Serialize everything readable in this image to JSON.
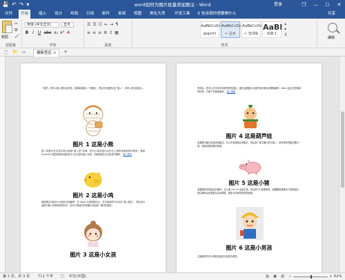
{
  "window": {
    "title": "word如何为图片批量添加题注 - Word",
    "login": "登录",
    "controls": {
      "restore": "❐",
      "minimize": "—",
      "maximize": "☐",
      "close": "✕"
    }
  },
  "qat": {
    "save": "💾",
    "undo": "↶",
    "redo": "↷",
    "more": "▾"
  },
  "tabs": [
    "文件",
    "开始",
    "插入",
    "设计",
    "布局",
    "引用",
    "邮件",
    "审阅",
    "视图",
    "美化大师",
    "开发工具"
  ],
  "active_tab": "开始",
  "tell_me": "♀ 告诉我你想要做什么",
  "share": "共享",
  "ribbon": {
    "clipboard": {
      "paste_label": "粘贴",
      "group_label": "剪贴板"
    },
    "font": {
      "font_name": "宋体 (中文正文)",
      "font_size": "五号",
      "row2": [
        "B",
        "I",
        "U",
        "abc",
        "x₂",
        "x²",
        "A"
      ],
      "group_label": "字体"
    },
    "paragraph": {
      "row1": [
        "☰",
        "☰",
        "☷",
        "⇤",
        "⇥",
        "¶"
      ],
      "row2": [
        "≡",
        "≡",
        "≡",
        "≣",
        "↕",
        "▦"
      ],
      "group_label": "段落"
    },
    "styles": {
      "tiles": [
        {
          "sample": "AaBbCcDc",
          "name": "gogoshi"
        },
        {
          "sample": "AaBbCcDc",
          "name": "↵ 正文"
        },
        {
          "sample": "AaBbCcDc",
          "name": "↵ 无间隔"
        },
        {
          "sample": "AaBl",
          "name": "标题 1"
        }
      ],
      "group_label": "样式"
    },
    "editing": {
      "label": "编辑"
    }
  },
  "doc_tab": {
    "label": "撰新签区",
    "close": "×",
    "new": "+"
  },
  "doc_toolbar": {
    "new_doc": "🗋",
    "folder": "📁",
    "other": "▭"
  },
  "pages": {
    "left": {
      "intro_text": "一般的，您可以插入图片到文档，如果单独插入一张图片，然后在右键里点击“插入”，即可以在此处插入。",
      "captions": [
        "图片 1 这是小熊",
        "图片 2 这是小鸡",
        "图片 3 这是小女孩"
      ],
      "para2": "插入的图片在文档中默认使用“嵌入型”布局，您可以选中图片后在右上角的布局选项中更改。使用 SmartArt 图形和其他功能也可以在文档中插入对象，并使用题注为对象进行编号。",
      "para2_link": "插入题注",
      "para3": "使用题注功能可以为图片自动编号。在 Word 中选择图片后，在引用选项卡中点击“插入题注”，然后在对话框中输入标签和说明文字，即可以快速为所有图片添加统一格式的题注。"
    },
    "right": {
      "intro_text": "完成后，您可以在文档中查看所有的题注，题注会随图片位置的变化而自动更新编号。Word 会记住您使用的标签，方便下次继续使用。",
      "intro_link": "插入表格",
      "captions": [
        "图片 4 这是葫芦娃",
        "图片 5 这是小猪",
        "图片 6 这是小男孩"
      ],
      "para2": "如果要为图片批量添加题注，可以先设置题注的格式，然后逐个选中图片进行插入，这样得到的题注格式一致，排版也更加整齐美观。",
      "para3": "若要更新所有题注的编号，可以按 Ctrl+A 全选文档，然后按 F9 键更新域。如果删除或移动了某张图片，题注编号会在更新后自动调整，避免手动修改带来的错误。",
      "para4": "主题和样式可以帮助您保持文档的协调性。"
    }
  },
  "status": {
    "page": "第 2 页，共 3 页",
    "words": "711 个字",
    "track": "□",
    "language": "中文(中国)",
    "zoom": "62%",
    "zoom_fraction": 0.62
  }
}
